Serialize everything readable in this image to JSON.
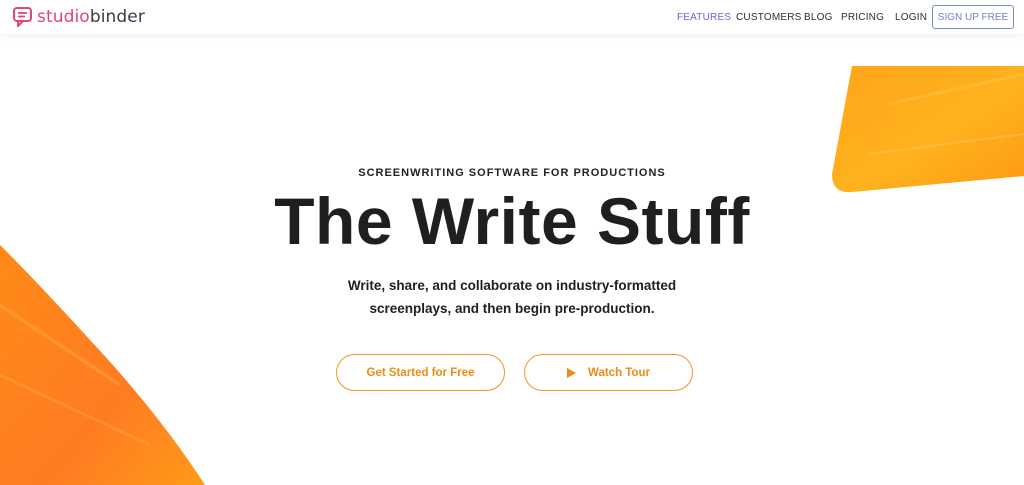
{
  "header": {
    "logo": {
      "prefix": "studio",
      "suffix": "binder",
      "icon": "chat-bubble-icon"
    },
    "nav": {
      "features": "FEATURES",
      "customers": "CUSTOMERS",
      "blog": "BLOG",
      "pricing": "PRICING",
      "login": "LOGIN",
      "signup": "SIGN UP FREE"
    }
  },
  "hero": {
    "kicker": "SCREENWRITING SOFTWARE FOR PRODUCTIONS",
    "title": "The Write Stuff",
    "subtitle_line1": "Write, share, and collaborate on industry-formatted",
    "subtitle_line2": "screenplays, and then begin pre-production.",
    "cta_primary": "Get Started for Free",
    "cta_secondary": "Watch Tour",
    "cta_secondary_icon": "play-icon"
  },
  "colors": {
    "brand_pink": "#e0457b",
    "nav_active": "#6f63d9",
    "signup_border": "#7b8ad6",
    "accent_orange": "#f29522"
  }
}
